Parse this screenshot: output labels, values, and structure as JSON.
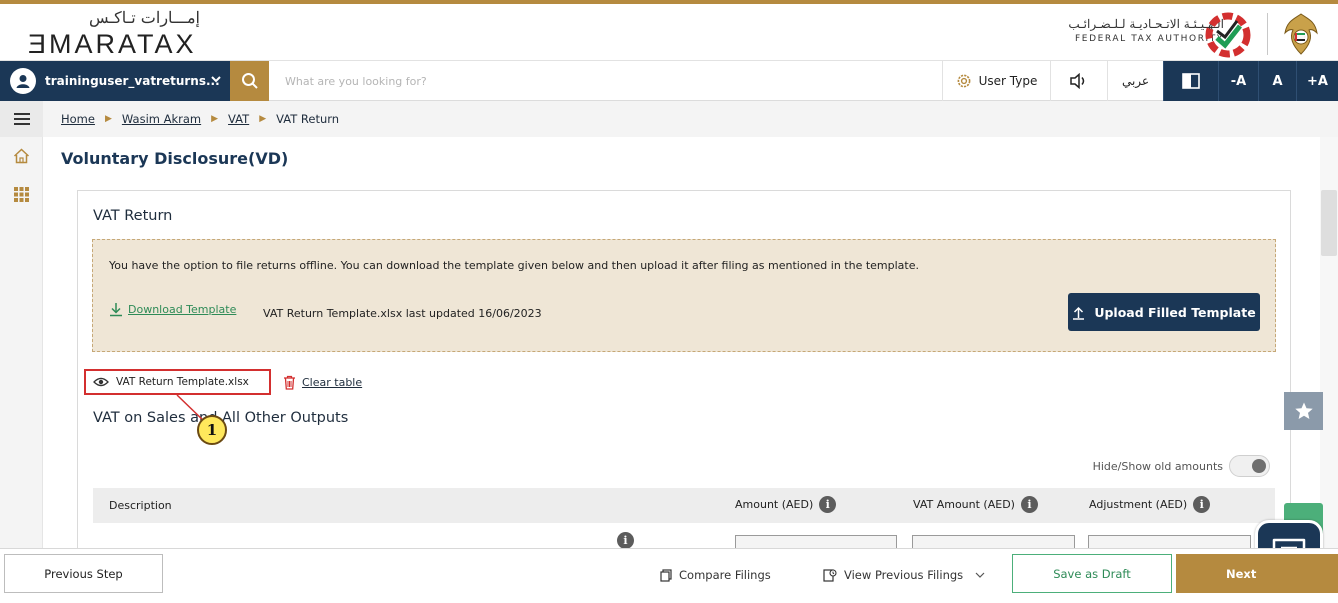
{
  "branding": {
    "left_logo_arabic": "إمـــارات تـاكـس",
    "left_logo_english": "ƎMARATAX",
    "right_logo_arabic": "الـهـيـئـة الاتـحـاديـة لـلـضـرائـب",
    "right_logo_english": "FEDERAL TAX AUTHORITY"
  },
  "topbar": {
    "username": "traininguser_vatreturns...",
    "search_placeholder": "What are you looking for?",
    "user_type_label": "User Type",
    "arabic_label": "عربي",
    "font_decrease": "-A",
    "font_normal": "A",
    "font_increase": "+A"
  },
  "breadcrumb": {
    "items": [
      "Home",
      "Wasim Akram",
      "VAT"
    ],
    "current": "VAT Return"
  },
  "page": {
    "title": "Voluntary Disclosure(VD)"
  },
  "card": {
    "title": "VAT Return",
    "offline_message": "You have the option to file returns offline. You can download the template given below and then upload it after filing as mentioned in the template.",
    "download_label": "Download Template",
    "template_info": "VAT Return Template.xlsx last updated 16/06/2023",
    "upload_label": "Upload Filled Template",
    "file_chip_label": "VAT Return Template.xlsx",
    "clear_table_label": "Clear table",
    "callout_number": "1",
    "section_title": "VAT on Sales and All Other Outputs",
    "toggle_label": "Hide/Show old amounts"
  },
  "table": {
    "columns": [
      "Description",
      "Amount (AED)",
      "VAT Amount (AED)",
      "Adjustment (AED)"
    ]
  },
  "footer": {
    "previous_label": "Previous Step",
    "compare_label": "Compare Filings",
    "view_previous_label": "View Previous Filings",
    "save_draft_label": "Save as Draft",
    "next_label": "Next"
  },
  "colors": {
    "navy": "#1b3756",
    "gold": "#b58a3f",
    "green": "#2e8b57",
    "offline_bg": "#efe6d6",
    "highlight_red": "#d32f2f"
  }
}
